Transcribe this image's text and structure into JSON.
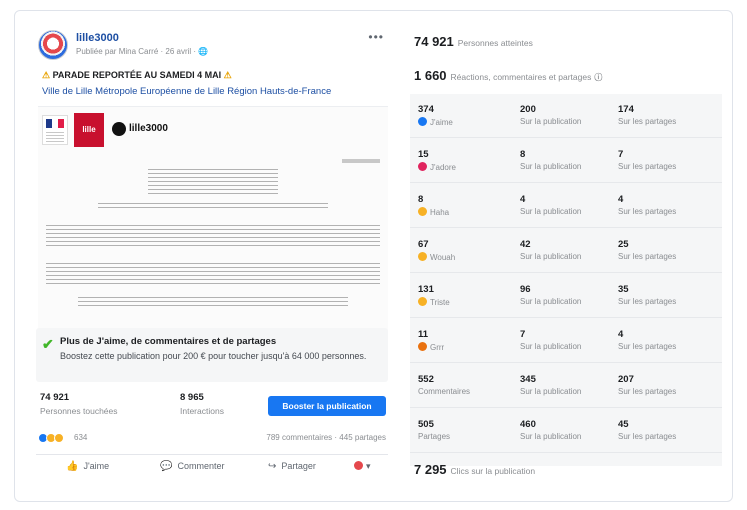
{
  "post": {
    "page_name": "lille3000",
    "meta": "Publiée par Mina Carré · 26 avril · 🌐",
    "headline": "PARADE REPORTÉE AU SAMEDI 4 MAI",
    "tags": "Ville de Lille Métropole Européenne de Lille Région Hauts-de-France",
    "doc": {
      "brand": "lille3000",
      "lille_logo": "lille"
    },
    "boost": {
      "title": "Plus de J'aime, de commentaires et de partages",
      "desc": "Boostez cette publication pour 200 € pour toucher jusqu'à 64 000 personnes."
    },
    "stats": [
      {
        "value": "74 921",
        "label": "Personnes touchées"
      },
      {
        "value": "8 965",
        "label": "Interactions"
      }
    ],
    "boost_button": "Booster la publication",
    "reaction_count": "634",
    "reaction_summary": "789 commentaires · 445 partages",
    "actions": [
      {
        "icon": "thumbs-up-icon",
        "label": "J'aime"
      },
      {
        "icon": "comment-icon",
        "label": "Commenter"
      },
      {
        "icon": "share-icon",
        "label": "Partager"
      }
    ]
  },
  "insights": {
    "reach_value": "74 921",
    "reach_label": "Personnes atteintes",
    "engagement_value": "1 660",
    "engagement_label": "Réactions, commentaires et partages",
    "rows": [
      {
        "name": "like",
        "color": "#1877f2",
        "total": "374",
        "label": "J'aime",
        "on_post": "200",
        "on_shares": "174"
      },
      {
        "name": "love",
        "color": "#e0245e",
        "total": "15",
        "label": "J'adore",
        "on_post": "8",
        "on_shares": "7"
      },
      {
        "name": "haha",
        "color": "#f7b125",
        "total": "8",
        "label": "Haha",
        "on_post": "4",
        "on_shares": "4"
      },
      {
        "name": "wow",
        "color": "#f7b125",
        "total": "67",
        "label": "Wouah",
        "on_post": "42",
        "on_shares": "25"
      },
      {
        "name": "sad",
        "color": "#f7b125",
        "total": "131",
        "label": "Triste",
        "on_post": "96",
        "on_shares": "35"
      },
      {
        "name": "angry",
        "color": "#e9710f",
        "total": "11",
        "label": "Grrr",
        "on_post": "7",
        "on_shares": "4"
      },
      {
        "name": "comments",
        "color": "",
        "total": "552",
        "label": "Commentaires",
        "on_post": "345",
        "on_shares": "207"
      },
      {
        "name": "shares",
        "color": "",
        "total": "505",
        "label": "Partages",
        "on_post": "460",
        "on_shares": "45"
      }
    ],
    "col_post_label": "Sur la publication",
    "col_shares_label": "Sur les partages",
    "clicks_value": "7 295",
    "clicks_label": "Clics sur la publication"
  }
}
